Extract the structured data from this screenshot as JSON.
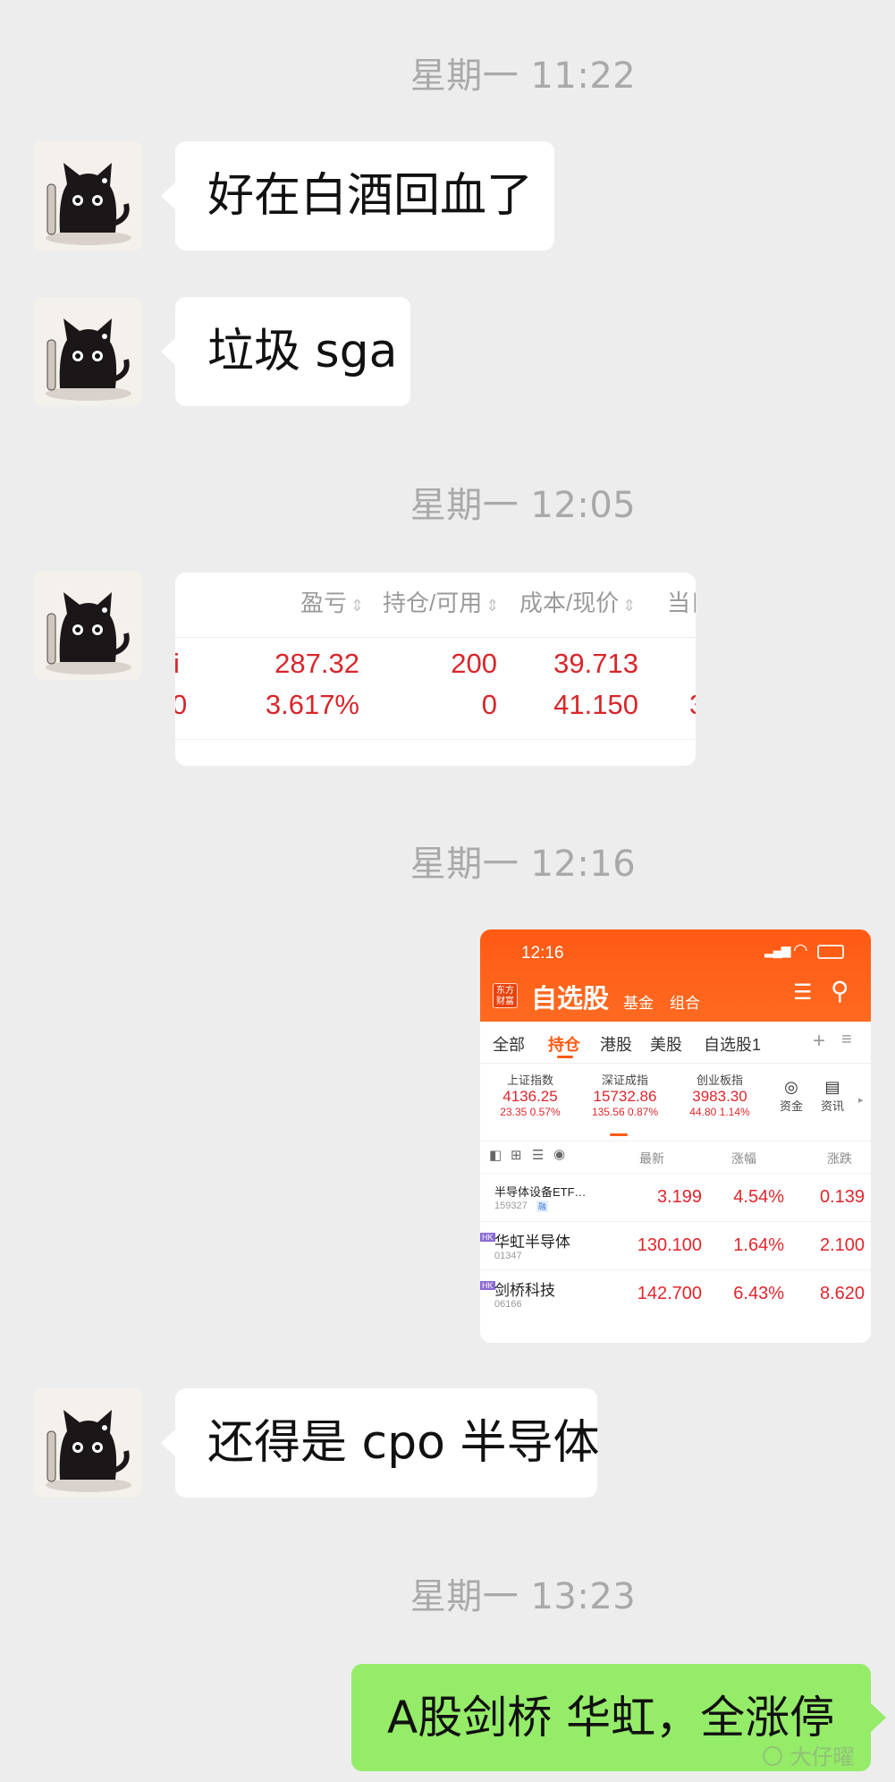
{
  "chat": {
    "time1": "星期一 11:22",
    "msg1": "好在白酒回血了",
    "msg2": "垃圾 sga",
    "time2": "星期一 12:05",
    "time3": "星期一 12:16",
    "msg4": "还得是 cpo 半导体",
    "time4": "星期一 13:23",
    "msg5": "A股剑桥 华虹，全涨停",
    "watermark": "〇 大仔曜"
  },
  "holding_crop": {
    "headers": [
      "盈亏",
      "持仓/可用",
      "成本/现价",
      "当日"
    ],
    "row1": [
      "287.32",
      "200",
      "39.713"
    ],
    "row2": [
      "3.617%",
      "0",
      "41.150"
    ],
    "left_cut": [
      "i",
      "0"
    ],
    "right_cut": "3"
  },
  "app": {
    "time": "12:16",
    "logo": [
      "东方",
      "财富"
    ],
    "title": "自选股",
    "nav_fund": "基金",
    "nav_combo": "组合",
    "tabs": [
      "全部",
      "持仓",
      "港股",
      "美股",
      "自选股1"
    ],
    "active_tab": "持仓",
    "indices": [
      {
        "name": "上证指数",
        "value": "4136.25",
        "change": "23.35",
        "pct": "0.57%"
      },
      {
        "name": "深证成指",
        "value": "15732.86",
        "change": "135.56",
        "pct": "0.87%"
      },
      {
        "name": "创业板指",
        "value": "3983.30",
        "change": "44.80",
        "pct": "1.14%"
      }
    ],
    "tool_fund": "资金",
    "tool_news": "资讯",
    "col_latest": "最新",
    "col_pct": "涨幅",
    "col_change": "涨跌",
    "stocks": [
      {
        "name": "半导体设备ETF…",
        "code": "159327",
        "tag": "融",
        "price": "3.199",
        "pct": "4.54%",
        "change": "0.139"
      },
      {
        "name": "华虹半导体",
        "code": "01347",
        "tag": "HK",
        "price": "130.100",
        "pct": "1.64%",
        "change": "2.100"
      },
      {
        "name": "剑桥科技",
        "code": "06166",
        "tag": "HK",
        "price": "142.700",
        "pct": "6.43%",
        "change": "8.620"
      }
    ]
  }
}
